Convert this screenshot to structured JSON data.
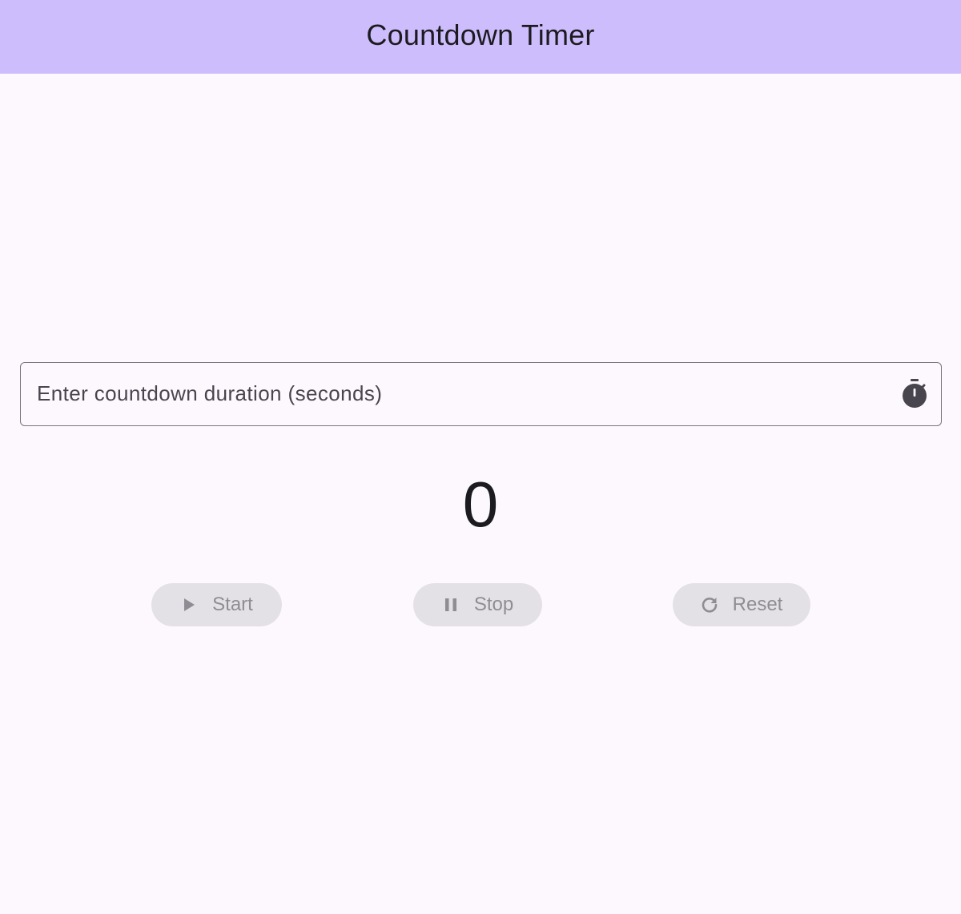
{
  "app_bar": {
    "title": "Countdown Timer",
    "background": "#cebdfd"
  },
  "duration_input": {
    "placeholder": "Enter countdown duration (seconds)",
    "value": "",
    "trailing_icon": "timer-icon"
  },
  "countdown": {
    "value": "0"
  },
  "controls": {
    "start": {
      "label": "Start",
      "icon": "play-icon",
      "enabled": false
    },
    "stop": {
      "label": "Stop",
      "icon": "pause-icon",
      "enabled": false
    },
    "reset": {
      "label": "Reset",
      "icon": "refresh-icon",
      "enabled": false
    }
  },
  "colors": {
    "surface": "#fdf8fd",
    "disabled_button_bg": "#e4e1e6",
    "disabled_button_text": "#8f8c93",
    "on_surface": "#1c1b1f",
    "outline": "#79747e",
    "icon": "#49454f"
  }
}
